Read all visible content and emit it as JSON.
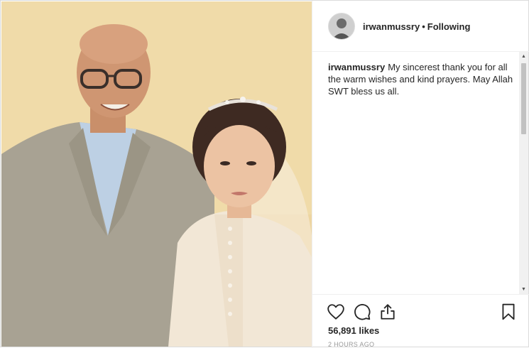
{
  "post": {
    "username": "irwanmussry",
    "separator": "•",
    "follow_status": "Following",
    "caption_user": "irwanmussry",
    "caption_text": "My sincerest thank you for all the warm wishes and kind prayers. May Allah SWT bless us all.",
    "likes": "56,891 likes",
    "time": "2 HOURS AGO"
  },
  "icons": {
    "like": "heart-icon",
    "comment": "comment-icon",
    "share": "share-icon",
    "save": "bookmark-icon"
  },
  "colors": {
    "text": "#262626",
    "muted": "#999999",
    "border": "#dbdbdb"
  }
}
